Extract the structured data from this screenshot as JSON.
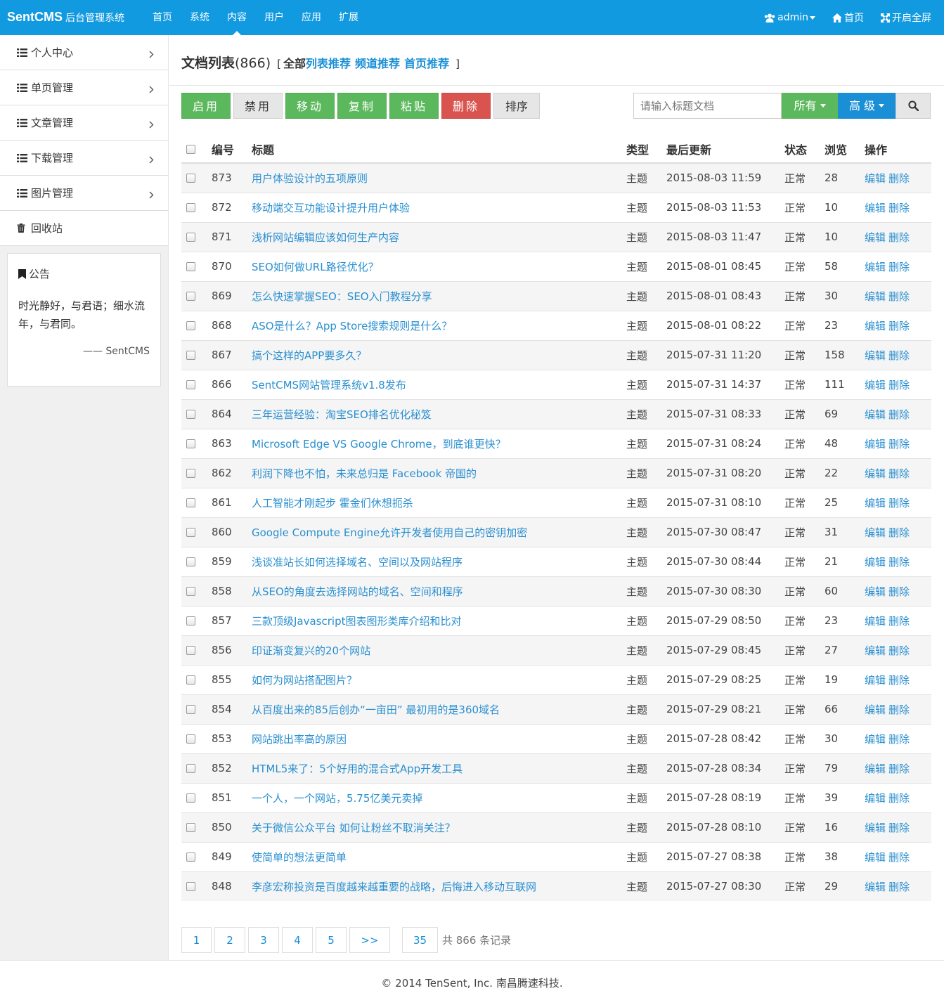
{
  "brand": {
    "name": "SentCMS",
    "subtitle": "后台管理系统"
  },
  "nav": {
    "items": [
      {
        "label": "首页"
      },
      {
        "label": "系统"
      },
      {
        "label": "内容",
        "active": true
      },
      {
        "label": "用户"
      },
      {
        "label": "应用"
      },
      {
        "label": "扩展"
      }
    ],
    "right": {
      "user": "admin",
      "home": "首页",
      "fullscreen": "开启全屏"
    }
  },
  "sidebar": {
    "items": [
      {
        "label": "个人中心",
        "icon": "list-icon",
        "has_arrow": true
      },
      {
        "label": "单页管理",
        "icon": "list-icon",
        "has_arrow": true
      },
      {
        "label": "文章管理",
        "icon": "list-icon",
        "has_arrow": true
      },
      {
        "label": "下载管理",
        "icon": "list-icon",
        "has_arrow": true
      },
      {
        "label": "图片管理",
        "icon": "list-icon",
        "has_arrow": true
      },
      {
        "label": "回收站",
        "icon": "trash-icon",
        "has_arrow": false
      }
    ],
    "notice": {
      "title": "公告",
      "body": "时光静好，与君语；细水流年，与君同。",
      "signature": "—— SentCMS"
    }
  },
  "page": {
    "title": "文档列表",
    "count": "(866)",
    "bracket_open": "[",
    "bracket_close": "]",
    "filters": [
      {
        "label": "全部",
        "active": true
      },
      {
        "label": "列表推荐"
      },
      {
        "label": "频道推荐"
      },
      {
        "label": "首页推荐"
      }
    ]
  },
  "toolbar": {
    "buttons": [
      {
        "label": "启用",
        "style": "green"
      },
      {
        "label": "禁用",
        "style": "gray"
      },
      {
        "label": "移动",
        "style": "green"
      },
      {
        "label": "复制",
        "style": "green"
      },
      {
        "label": "粘贴",
        "style": "green"
      },
      {
        "label": "删除",
        "style": "red"
      },
      {
        "label": "排序",
        "style": "gray"
      }
    ]
  },
  "search": {
    "placeholder": "请输入标题文档",
    "status_filter": "所有",
    "advanced": "高 级"
  },
  "table": {
    "headers": {
      "id": "编号",
      "title": "标题",
      "type": "类型",
      "updated": "最后更新",
      "status": "状态",
      "views": "浏览",
      "actions": "操作"
    },
    "edit_label": "编辑",
    "delete_label": "删除",
    "rows": [
      {
        "id": "873",
        "title": "用户体验设计的五项原则",
        "type": "主题",
        "updated": "2015-08-03 11:59",
        "status": "正常",
        "views": "28"
      },
      {
        "id": "872",
        "title": "移动端交互功能设计提升用户体验",
        "type": "主题",
        "updated": "2015-08-03 11:53",
        "status": "正常",
        "views": "10"
      },
      {
        "id": "871",
        "title": "浅析网站编辑应该如何生产内容",
        "type": "主题",
        "updated": "2015-08-03 11:47",
        "status": "正常",
        "views": "10"
      },
      {
        "id": "870",
        "title": "SEO如何做URL路径优化？",
        "type": "主题",
        "updated": "2015-08-01 08:45",
        "status": "正常",
        "views": "58"
      },
      {
        "id": "869",
        "title": "怎么快速掌握SEO：SEO入门教程分享",
        "type": "主题",
        "updated": "2015-08-01 08:43",
        "status": "正常",
        "views": "30"
      },
      {
        "id": "868",
        "title": "ASO是什么？App Store搜索规则是什么？",
        "type": "主题",
        "updated": "2015-08-01 08:22",
        "status": "正常",
        "views": "23"
      },
      {
        "id": "867",
        "title": "搞个这样的APP要多久？",
        "type": "主题",
        "updated": "2015-07-31 11:20",
        "status": "正常",
        "views": "158"
      },
      {
        "id": "866",
        "title": "SentCMS网站管理系统v1.8发布",
        "type": "主题",
        "updated": "2015-07-31 14:37",
        "status": "正常",
        "views": "111"
      },
      {
        "id": "864",
        "title": "三年运营经验：淘宝SEO排名优化秘笈",
        "type": "主题",
        "updated": "2015-07-31 08:33",
        "status": "正常",
        "views": "69"
      },
      {
        "id": "863",
        "title": "Microsoft Edge VS Google Chrome，到底谁更快？",
        "type": "主题",
        "updated": "2015-07-31 08:24",
        "status": "正常",
        "views": "48"
      },
      {
        "id": "862",
        "title": "利润下降也不怕，未来总归是 Facebook 帝国的",
        "type": "主题",
        "updated": "2015-07-31 08:20",
        "status": "正常",
        "views": "22"
      },
      {
        "id": "861",
        "title": "人工智能才刚起步 霍金们休想扼杀",
        "type": "主题",
        "updated": "2015-07-31 08:10",
        "status": "正常",
        "views": "25"
      },
      {
        "id": "860",
        "title": "Google Compute Engine允许开发者使用自己的密钥加密",
        "type": "主题",
        "updated": "2015-07-30 08:47",
        "status": "正常",
        "views": "31"
      },
      {
        "id": "859",
        "title": "浅谈准站长如何选择域名、空间以及网站程序",
        "type": "主题",
        "updated": "2015-07-30 08:44",
        "status": "正常",
        "views": "21"
      },
      {
        "id": "858",
        "title": "从SEO的角度去选择网站的域名、空间和程序",
        "type": "主题",
        "updated": "2015-07-30 08:30",
        "status": "正常",
        "views": "60"
      },
      {
        "id": "857",
        "title": "三款顶级Javascript图表图形类库介绍和比对",
        "type": "主题",
        "updated": "2015-07-29 08:50",
        "status": "正常",
        "views": "23"
      },
      {
        "id": "856",
        "title": "印证渐变复兴的20个网站",
        "type": "主题",
        "updated": "2015-07-29 08:45",
        "status": "正常",
        "views": "27"
      },
      {
        "id": "855",
        "title": "如何为网站搭配图片？",
        "type": "主题",
        "updated": "2015-07-29 08:25",
        "status": "正常",
        "views": "19"
      },
      {
        "id": "854",
        "title": "从百度出来的85后创办“一亩田” 最初用的是360域名",
        "type": "主题",
        "updated": "2015-07-29 08:21",
        "status": "正常",
        "views": "66"
      },
      {
        "id": "853",
        "title": "网站跳出率高的原因",
        "type": "主题",
        "updated": "2015-07-28 08:42",
        "status": "正常",
        "views": "30"
      },
      {
        "id": "852",
        "title": "HTML5来了：5个好用的混合式App开发工具",
        "type": "主题",
        "updated": "2015-07-28 08:34",
        "status": "正常",
        "views": "79"
      },
      {
        "id": "851",
        "title": "一个人，一个网站，5.75亿美元卖掉",
        "type": "主题",
        "updated": "2015-07-28 08:19",
        "status": "正常",
        "views": "39"
      },
      {
        "id": "850",
        "title": "关于微信公众平台 如何让粉丝不取消关注？",
        "type": "主题",
        "updated": "2015-07-28 08:10",
        "status": "正常",
        "views": "16"
      },
      {
        "id": "849",
        "title": "使简单的想法更简单",
        "type": "主题",
        "updated": "2015-07-27 08:38",
        "status": "正常",
        "views": "38"
      },
      {
        "id": "848",
        "title": "李彦宏称投资是百度越来越重要的战略，后悔进入移动互联网",
        "type": "主题",
        "updated": "2015-07-27 08:30",
        "status": "正常",
        "views": "29"
      }
    ]
  },
  "pagination": {
    "pages": [
      "1",
      "2",
      "3",
      "4",
      "5",
      ">>",
      "35"
    ],
    "summary": "共 866 条记录"
  },
  "footer": {
    "text": "© 2014 TenSent, Inc. 南昌腾速科技."
  },
  "colors": {
    "primary": "#129ae0",
    "success": "#5cb85c",
    "danger": "#d9534f",
    "link": "#2a8fd0"
  }
}
